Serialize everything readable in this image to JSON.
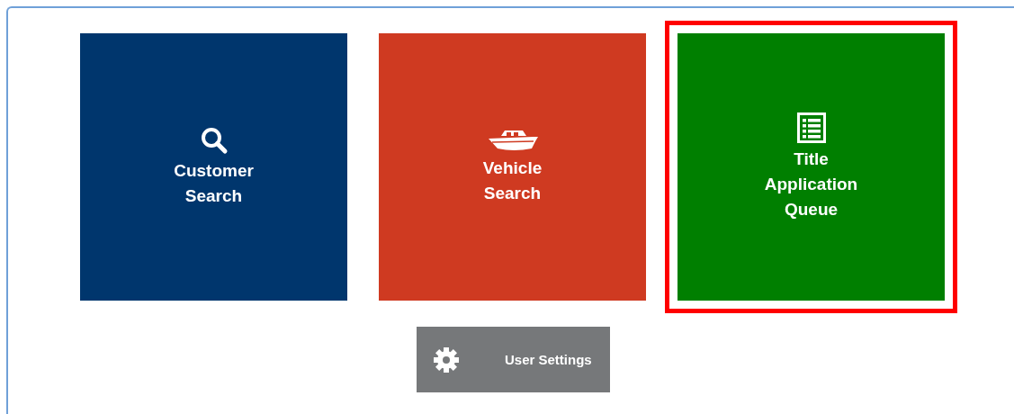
{
  "tiles": [
    {
      "kind": "search",
      "label": "Customer Search",
      "color": "#00366d",
      "selected": false
    },
    {
      "kind": "boat",
      "label": "Vehicle Search",
      "color": "#cf3a21",
      "selected": false
    },
    {
      "kind": "list",
      "label": "Title Application Queue",
      "color": "#007f00",
      "selected": true
    }
  ],
  "settings_button": {
    "label": "User Settings"
  }
}
